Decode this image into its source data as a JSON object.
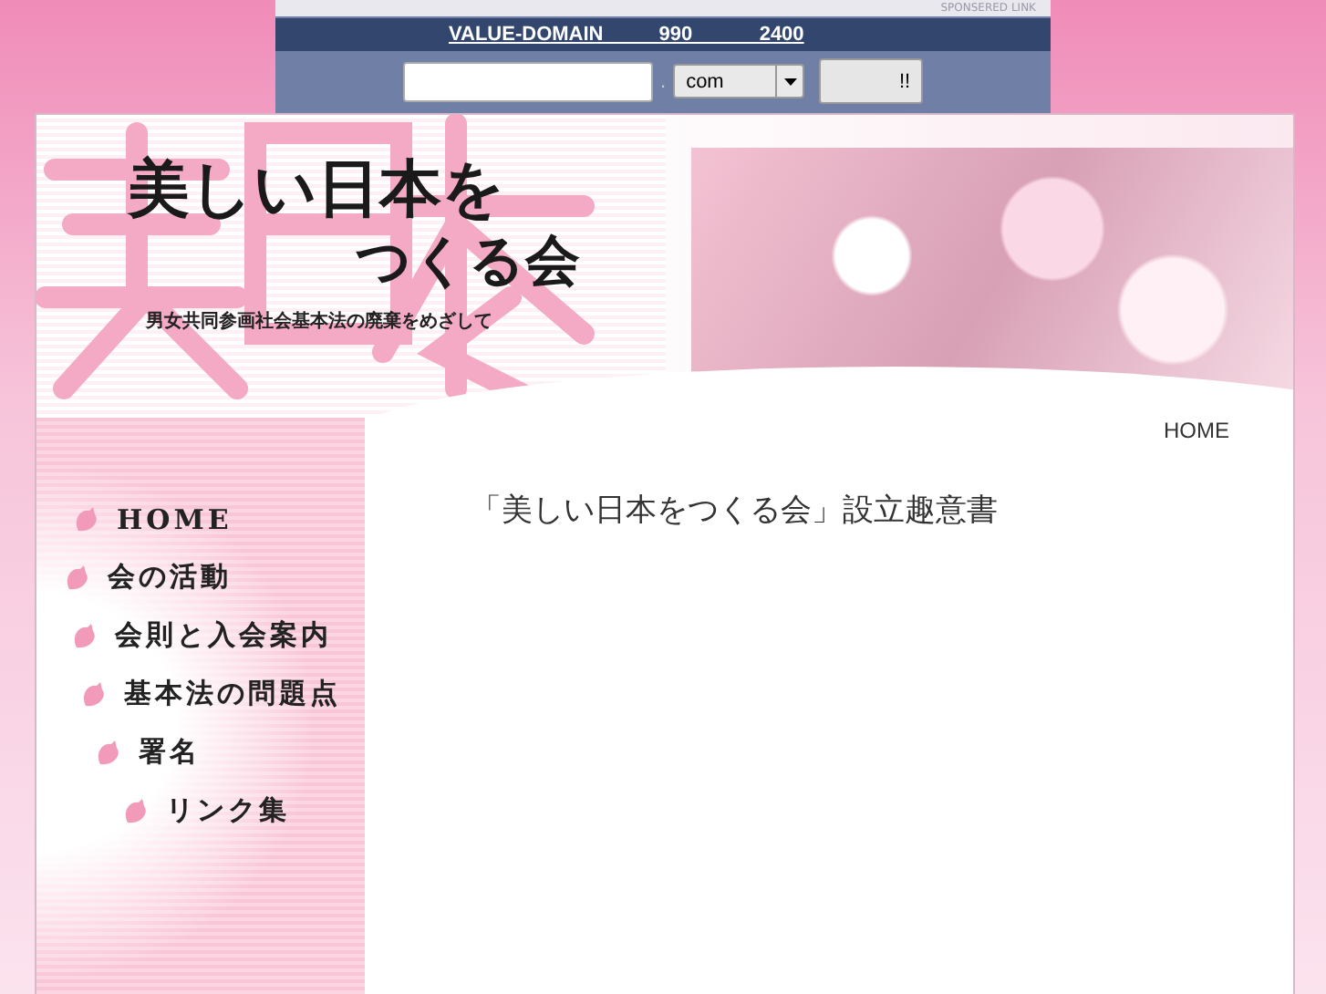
{
  "sponsor": {
    "caption": "SPONSERED LINK",
    "link": "VALUE-DOMAIN          990            2400",
    "separator": ".",
    "tld": "com",
    "button": "!!"
  },
  "header": {
    "title_line1": "美しい日本を",
    "title_line2": "つくる会",
    "subtitle": "男女共同参画社会基本法の廃棄をめざして"
  },
  "sidebar": {
    "items": [
      {
        "label": "HOME"
      },
      {
        "label": "会の活動"
      },
      {
        "label": "会則と入会案内"
      },
      {
        "label": "基本法の問題点"
      },
      {
        "label": "署名"
      },
      {
        "label": "リンク集"
      }
    ]
  },
  "content": {
    "breadcrumb": "HOME",
    "heading": "「美しい日本をつくる会」設立趣意書"
  }
}
